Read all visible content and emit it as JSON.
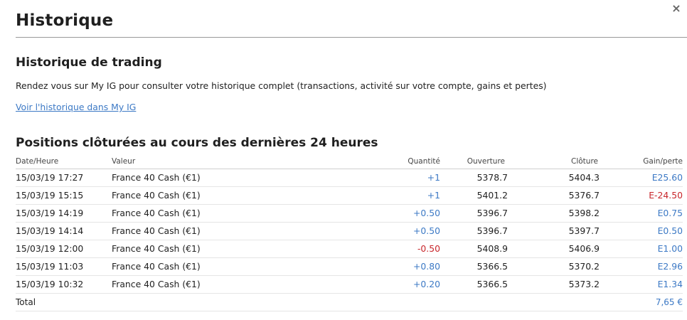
{
  "modal": {
    "title": "Historique",
    "close_label": "×"
  },
  "trading_history": {
    "heading": "Historique de trading",
    "description": "Rendez vous sur My IG pour consulter votre historique complet (transactions, activité sur votre compte, gains et pertes)",
    "link_label": "Voir l'historique dans My IG"
  },
  "positions": {
    "heading": "Positions clôturées au cours des dernières 24 heures",
    "columns": {
      "date": "Date/Heure",
      "value": "Valeur",
      "quantity": "Quantité",
      "open": "Ouverture",
      "close": "Clôture",
      "gain": "Gain/perte"
    },
    "rows": [
      {
        "date": "15/03/19 17:27",
        "value": "France 40 Cash (€1)",
        "quantity": "+1",
        "open": "5378.7",
        "close": "5404.3",
        "gain": "E25.60"
      },
      {
        "date": "15/03/19 15:15",
        "value": "France 40 Cash (€1)",
        "quantity": "+1",
        "open": "5401.2",
        "close": "5376.7",
        "gain": "E-24.50"
      },
      {
        "date": "15/03/19 14:19",
        "value": "France 40 Cash (€1)",
        "quantity": "+0.50",
        "open": "5396.7",
        "close": "5398.2",
        "gain": "E0.75"
      },
      {
        "date": "15/03/19 14:14",
        "value": "France 40 Cash (€1)",
        "quantity": "+0.50",
        "open": "5396.7",
        "close": "5397.7",
        "gain": "E0.50"
      },
      {
        "date": "15/03/19 12:00",
        "value": "France 40 Cash (€1)",
        "quantity": "-0.50",
        "open": "5408.9",
        "close": "5406.9",
        "gain": "E1.00"
      },
      {
        "date": "15/03/19 11:03",
        "value": "France 40 Cash (€1)",
        "quantity": "+0.80",
        "open": "5366.5",
        "close": "5370.2",
        "gain": "E2.96"
      },
      {
        "date": "15/03/19 10:32",
        "value": "France 40 Cash (€1)",
        "quantity": "+0.20",
        "open": "5366.5",
        "close": "5373.2",
        "gain": "E1.34"
      }
    ],
    "total_label": "Total",
    "total_value": "7,65 €"
  },
  "colors": {
    "positive": "#3c79c5",
    "negative": "#c8262b",
    "link": "#3c79c5"
  }
}
